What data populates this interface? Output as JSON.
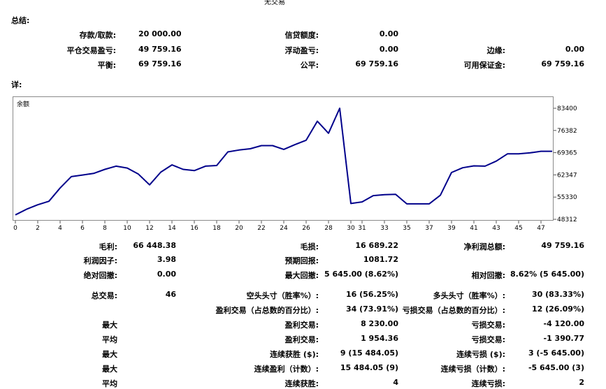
{
  "header": {
    "title": "无交易"
  },
  "summary": {
    "section_label": "总结:",
    "rows": [
      [
        {
          "label": "存款/取款:",
          "value": "20 000.00"
        },
        {
          "label": "信贷额度:",
          "value": "0.00"
        },
        {
          "label": "",
          "value": ""
        }
      ],
      [
        {
          "label": "平仓交易盈亏:",
          "value": "49 759.16"
        },
        {
          "label": "浮动盈亏:",
          "value": "0.00"
        },
        {
          "label": "边缘:",
          "value": "0.00"
        }
      ],
      [
        {
          "label": "平衡:",
          "value": "69 759.16"
        },
        {
          "label": "公平:",
          "value": "69 759.16"
        },
        {
          "label": "可用保证金:",
          "value": "69 759.16"
        }
      ]
    ]
  },
  "details": {
    "section_label": "详:"
  },
  "chart_data": {
    "type": "line",
    "title": "余额",
    "x": [
      0,
      1,
      2,
      3,
      4,
      5,
      6,
      7,
      8,
      9,
      10,
      11,
      12,
      13,
      14,
      15,
      16,
      17,
      18,
      19,
      20,
      21,
      22,
      23,
      24,
      25,
      26,
      27,
      28,
      29,
      30,
      31,
      32,
      33,
      34,
      35,
      36,
      37,
      38,
      39,
      40,
      41,
      42,
      43,
      44,
      45,
      46,
      47,
      48
    ],
    "series": [
      {
        "name": "",
        "values": [
          49700,
          51500,
          52900,
          54000,
          58200,
          61800,
          62300,
          62800,
          64100,
          65100,
          64500,
          62600,
          59200,
          63200,
          65500,
          64100,
          63700,
          65100,
          65300,
          69600,
          70200,
          70600,
          71600,
          71600,
          70400,
          71900,
          73300,
          79300,
          75500,
          83400,
          53300,
          53800,
          55800,
          56100,
          56200,
          53200,
          53200,
          53200,
          55900,
          63100,
          64600,
          65200,
          65100,
          66700,
          69000,
          69000,
          69300,
          69800,
          69800
        ]
      }
    ],
    "x_ticks": [
      "0",
      "2",
      "4",
      "6",
      "8",
      "10",
      "12",
      "14",
      "16",
      "18",
      "20",
      "22",
      "24",
      "26",
      "28",
      "30",
      "31",
      "33",
      "35",
      "37",
      "39",
      "41",
      "43",
      "45",
      "47"
    ],
    "y_ticks": [
      "83400",
      "76382",
      "69365",
      "62347",
      "55330",
      "48312"
    ],
    "ylim": [
      48312,
      83400
    ],
    "xlim": [
      0,
      48
    ],
    "line_color": "#00008b"
  },
  "stats": {
    "rows": [
      [
        {
          "label": "毛利:",
          "value": "66 448.38"
        },
        {
          "label": "毛损:",
          "value": "16 689.22"
        },
        {
          "label": "净利润总额:",
          "value": "49 759.16"
        }
      ],
      [
        {
          "label": "利润因子:",
          "value": "3.98"
        },
        {
          "label": "预期回报:",
          "value": "1081.72"
        },
        {
          "label": "",
          "value": ""
        }
      ],
      [
        {
          "label": "绝对回撤:",
          "value": "0.00"
        },
        {
          "label": "最大回撤:",
          "value": "5 645.00 (8.62%)"
        },
        {
          "label": "相对回撤:",
          "value": "8.62% (5 645.00)"
        }
      ],
      [
        {
          "label": "总交易:",
          "value": "46"
        },
        {
          "label": "空头头寸（胜率%）:",
          "value": "16 (56.25%)"
        },
        {
          "label": "多头头寸（胜率%）:",
          "value": "30 (83.33%)"
        }
      ],
      [
        {
          "label": "",
          "value": ""
        },
        {
          "label": "盈利交易（占总数的百分比）:",
          "value": "34 (73.91%)"
        },
        {
          "label": "亏损交易（占总数的百分比）:",
          "value": "12 (26.09%)"
        }
      ],
      [
        {
          "label": "最大",
          "value": ""
        },
        {
          "label": "盈利交易:",
          "value": "8 230.00"
        },
        {
          "label": "亏损交易:",
          "value": "-4 120.00"
        }
      ],
      [
        {
          "label": "平均",
          "value": ""
        },
        {
          "label": "盈利交易:",
          "value": "1 954.36"
        },
        {
          "label": "亏损交易:",
          "value": "-1 390.77"
        }
      ],
      [
        {
          "label": "最大",
          "value": ""
        },
        {
          "label": "连续获胜 ($):",
          "value": "9 (15 484.05)"
        },
        {
          "label": "连续亏损 ($):",
          "value": "3 (-5 645.00)"
        }
      ],
      [
        {
          "label": "最大",
          "value": ""
        },
        {
          "label": "连续盈利（计数）:",
          "value": "15 484.05 (9)"
        },
        {
          "label": "连续亏损（计数）:",
          "value": "-5 645.00 (3)"
        }
      ],
      [
        {
          "label": "平均",
          "value": ""
        },
        {
          "label": "连续获胜:",
          "value": "4"
        },
        {
          "label": "连续亏损:",
          "value": "2"
        }
      ]
    ]
  }
}
